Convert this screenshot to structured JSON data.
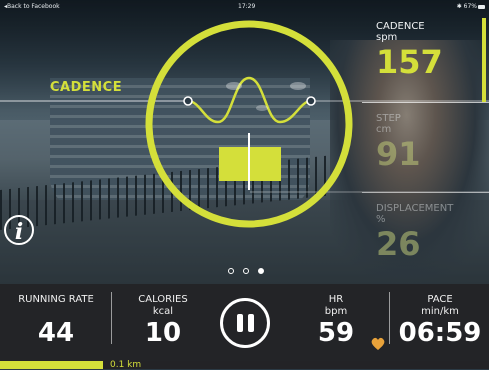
{
  "status_bar": {
    "back_text": "◂Back to Facebook",
    "time": "17:29",
    "battery": "✱ 67%"
  },
  "cadence_label": "CADENCE",
  "metrics": [
    {
      "name": "CADENCE",
      "unit": "spm",
      "value": "157"
    },
    {
      "name": "STEP",
      "unit": "cm",
      "value": "91"
    },
    {
      "name": "DISPLACEMENT",
      "unit": "%",
      "value": "26"
    }
  ],
  "info_icon": "info-icon",
  "page_dots": {
    "count": 3,
    "active_index": 2
  },
  "bottom_stats": {
    "running_rate": {
      "label": "RUNNING RATE",
      "unit": "",
      "value": "44"
    },
    "calories": {
      "label": "CALORIES",
      "unit": "kcal",
      "value": "10"
    },
    "hr": {
      "label": "HR",
      "unit": "bpm",
      "value": "59"
    },
    "pace": {
      "label": "PACE",
      "unit": "min/km",
      "value": "06:59"
    }
  },
  "distance": {
    "label": "0.1 km",
    "progress_fraction": 0.21
  },
  "colors": {
    "accent": "#d4df3a",
    "heart": "#e8a23a",
    "panel": "#232326"
  }
}
